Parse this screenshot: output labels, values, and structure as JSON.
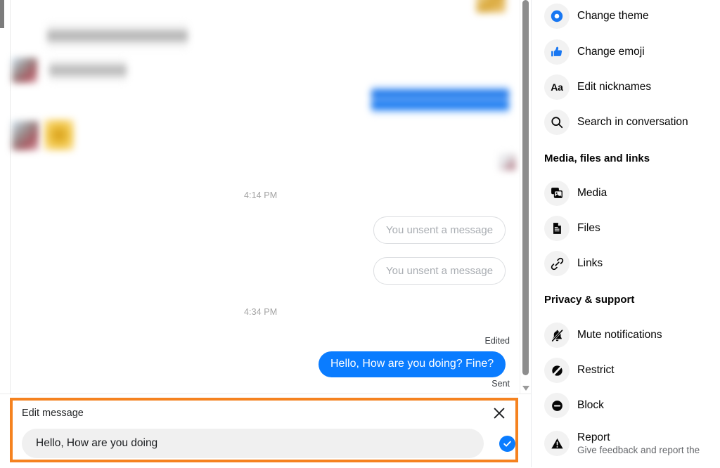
{
  "chat": {
    "timestamps": [
      "4:14 PM",
      "4:34 PM"
    ],
    "unsent_messages": [
      "You unsent a message",
      "You unsent a message"
    ],
    "edited_label": "Edited",
    "sent_bubble_text": "Hello, How are you doing? Fine?",
    "sent_status": "Sent",
    "bubble_color": "#0a7cff"
  },
  "edit_panel": {
    "title": "Edit message",
    "close_icon": "close-icon",
    "input_value": "Hello, How are you doing",
    "input_placeholder": "Edit message",
    "confirm_icon": "check-circle-icon",
    "highlight_color": "#f5821f"
  },
  "sidebar": {
    "groups": [
      {
        "heading": null,
        "items": [
          {
            "label": "Change theme",
            "icon": "theme-circle-icon"
          },
          {
            "label": "Change emoji",
            "icon": "thumbs-up-icon"
          },
          {
            "label": "Edit nicknames",
            "icon": "aa-text-icon"
          },
          {
            "label": "Search in conversation",
            "icon": "search-icon"
          }
        ]
      },
      {
        "heading": "Media, files and links",
        "items": [
          {
            "label": "Media",
            "icon": "media-photos-icon"
          },
          {
            "label": "Files",
            "icon": "file-document-icon"
          },
          {
            "label": "Links",
            "icon": "link-chain-icon"
          }
        ]
      },
      {
        "heading": "Privacy & support",
        "items": [
          {
            "label": "Mute notifications",
            "icon": "bell-slash-icon"
          },
          {
            "label": "Restrict",
            "icon": "restrict-slash-icon"
          },
          {
            "label": "Block",
            "icon": "block-minus-circle-icon"
          },
          {
            "label": "Report",
            "sub": "Give feedback and report the",
            "icon": "warning-triangle-icon"
          }
        ]
      }
    ]
  }
}
